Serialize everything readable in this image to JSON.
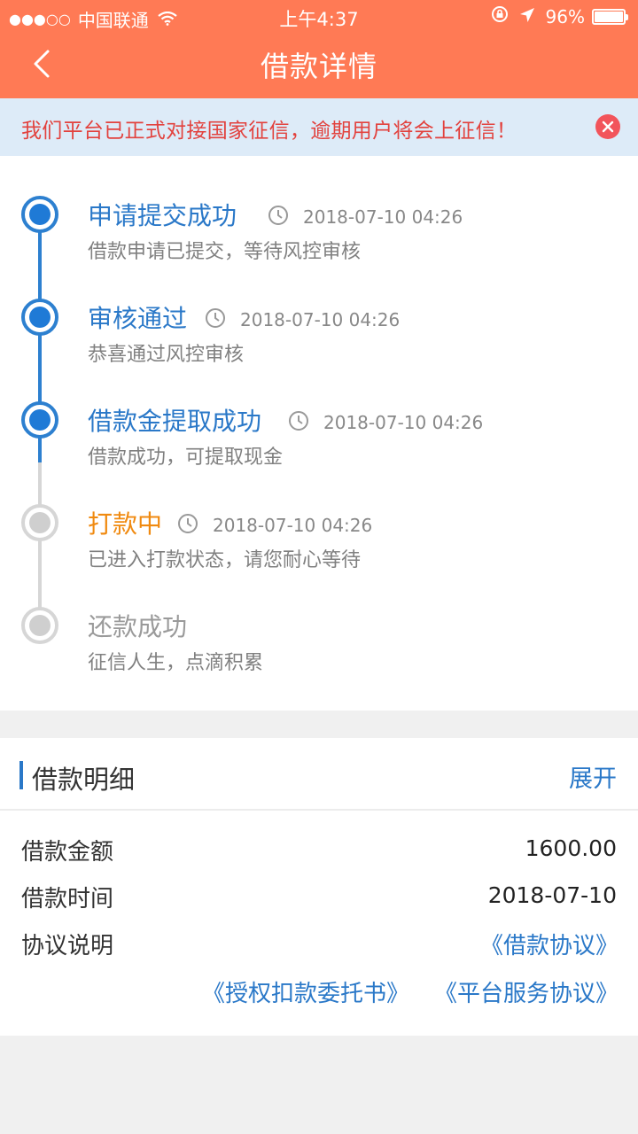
{
  "status_bar": {
    "signal": "●●●○○",
    "carrier": "中国联通",
    "time": "上午4:37",
    "battery": "96%"
  },
  "header": {
    "title": "借款详情",
    "background": "#ff7a55"
  },
  "notice": {
    "text": "我们平台已正式对接国家征信，逾期用户将会上征信！"
  },
  "timeline": {
    "steps": [
      {
        "title": "申请提交成功",
        "time": "2018-07-10 04:26",
        "desc": "借款申请已提交，等待风控审核",
        "state": "done"
      },
      {
        "title": "审核通过",
        "time": "2018-07-10 04:26",
        "desc": "恭喜通过风控审核",
        "state": "done"
      },
      {
        "title": "借款金提取成功",
        "time": "2018-07-10 04:26",
        "desc": "借款成功，可提取现金",
        "state": "done"
      },
      {
        "title": "打款中",
        "time": "2018-07-10 04:26",
        "desc": "已进入打款状态，请您耐心等待",
        "state": "current"
      },
      {
        "title": "还款成功",
        "desc": "征信人生，点滴积累",
        "state": "pending"
      }
    ]
  },
  "detail": {
    "title": "借款明细",
    "expand_label": "展开",
    "rows": [
      {
        "label": "借款金额",
        "value": "1600.00"
      },
      {
        "label": "借款时间",
        "value": "2018-07-10"
      },
      {
        "label": "协议说明"
      }
    ],
    "links": [
      "《借款协议》",
      "《授权扣款委托书》",
      "《平台服务协议》"
    ]
  },
  "colors": {
    "accent_blue": "#2a78c8",
    "current_orange": "#f08a10",
    "notice_red": "#e2423e"
  }
}
